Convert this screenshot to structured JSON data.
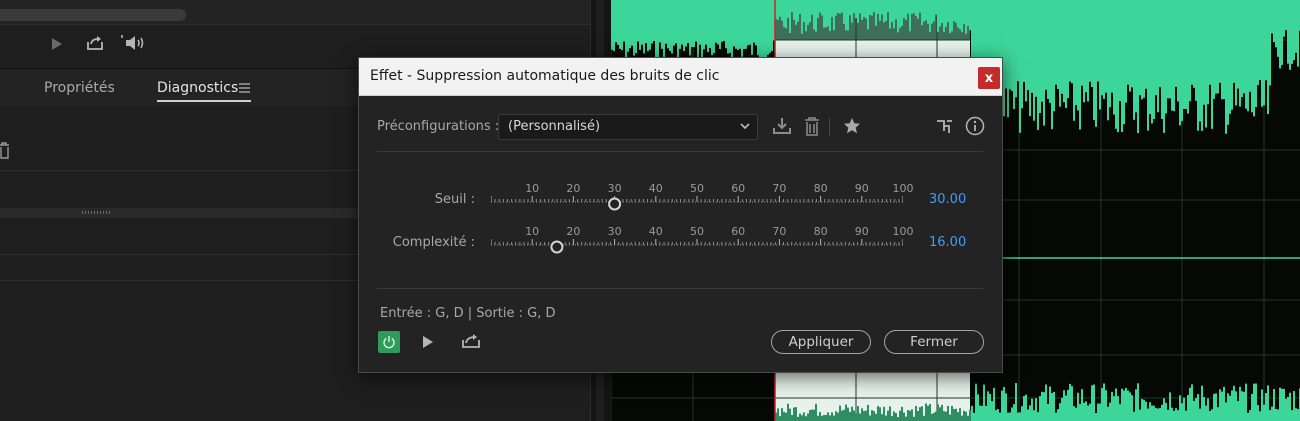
{
  "panel": {
    "tabs": [
      {
        "label": "Propriétés",
        "active": false
      },
      {
        "label": "Diagnostics",
        "active": true
      }
    ],
    "icons": [
      "play-icon",
      "export-icon",
      "speaker-icon",
      "panel-menu-icon",
      "trash-icon"
    ]
  },
  "dialog": {
    "title": "Effet - Suppression automatique des bruits de clic",
    "close_label": "x",
    "presets": {
      "label": "Préconfigurations :",
      "selected": "(Personnalisé)",
      "icons": [
        "download-preset-icon",
        "delete-preset-icon",
        "favorite-star-icon",
        "routing-icon",
        "info-icon"
      ]
    },
    "params": [
      {
        "label": "Seuil :",
        "value": "30.00",
        "fraction": 0.3
      },
      {
        "label": "Complexité :",
        "value": "16.00",
        "fraction": 0.16
      }
    ],
    "ticks": [
      "10",
      "20",
      "30",
      "40",
      "50",
      "60",
      "70",
      "80",
      "90",
      "100"
    ],
    "io": "Entrée : G, D | Sortie : G, D",
    "buttons": {
      "apply": "Appliquer",
      "close": "Fermer"
    }
  },
  "colors": {
    "accent_value": "#3f9cff",
    "power_on": "#2e9b5b",
    "waveform": "#3dd69a",
    "close_red": "#c42b2b"
  }
}
